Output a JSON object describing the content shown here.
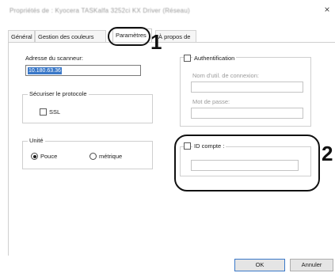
{
  "window": {
    "title": "Propriétés de : Kyocera TASKalfa 3252ci KX Driver (Réseau)",
    "close_glyph": "×"
  },
  "tabs": [
    {
      "label": "Général"
    },
    {
      "label": "Gestion des couleurs"
    },
    {
      "label": "Paramètres",
      "active": true
    },
    {
      "label": "À propos de"
    }
  ],
  "scanner": {
    "address_label": "Adresse du scanneur:",
    "address_value": "10.180.63.36"
  },
  "secure_group": {
    "title": "Sécuriser le protocole",
    "ssl_label": "SSL",
    "ssl_checked": false
  },
  "unit_group": {
    "title": "Unité",
    "options": [
      {
        "label": "Pouce",
        "checked": true
      },
      {
        "label": "métrique",
        "checked": false
      }
    ]
  },
  "auth_group": {
    "title": "Authentification",
    "checked": false,
    "login_label": "Nom d'util. de connexion:",
    "login_value": "",
    "password_label": "Mot de passe:",
    "password_value": ""
  },
  "account_group": {
    "title": "ID compte :",
    "checked": false,
    "value": ""
  },
  "buttons": {
    "ok": "OK",
    "cancel": "Annuler"
  },
  "callouts": {
    "one": "1",
    "two": "2"
  }
}
